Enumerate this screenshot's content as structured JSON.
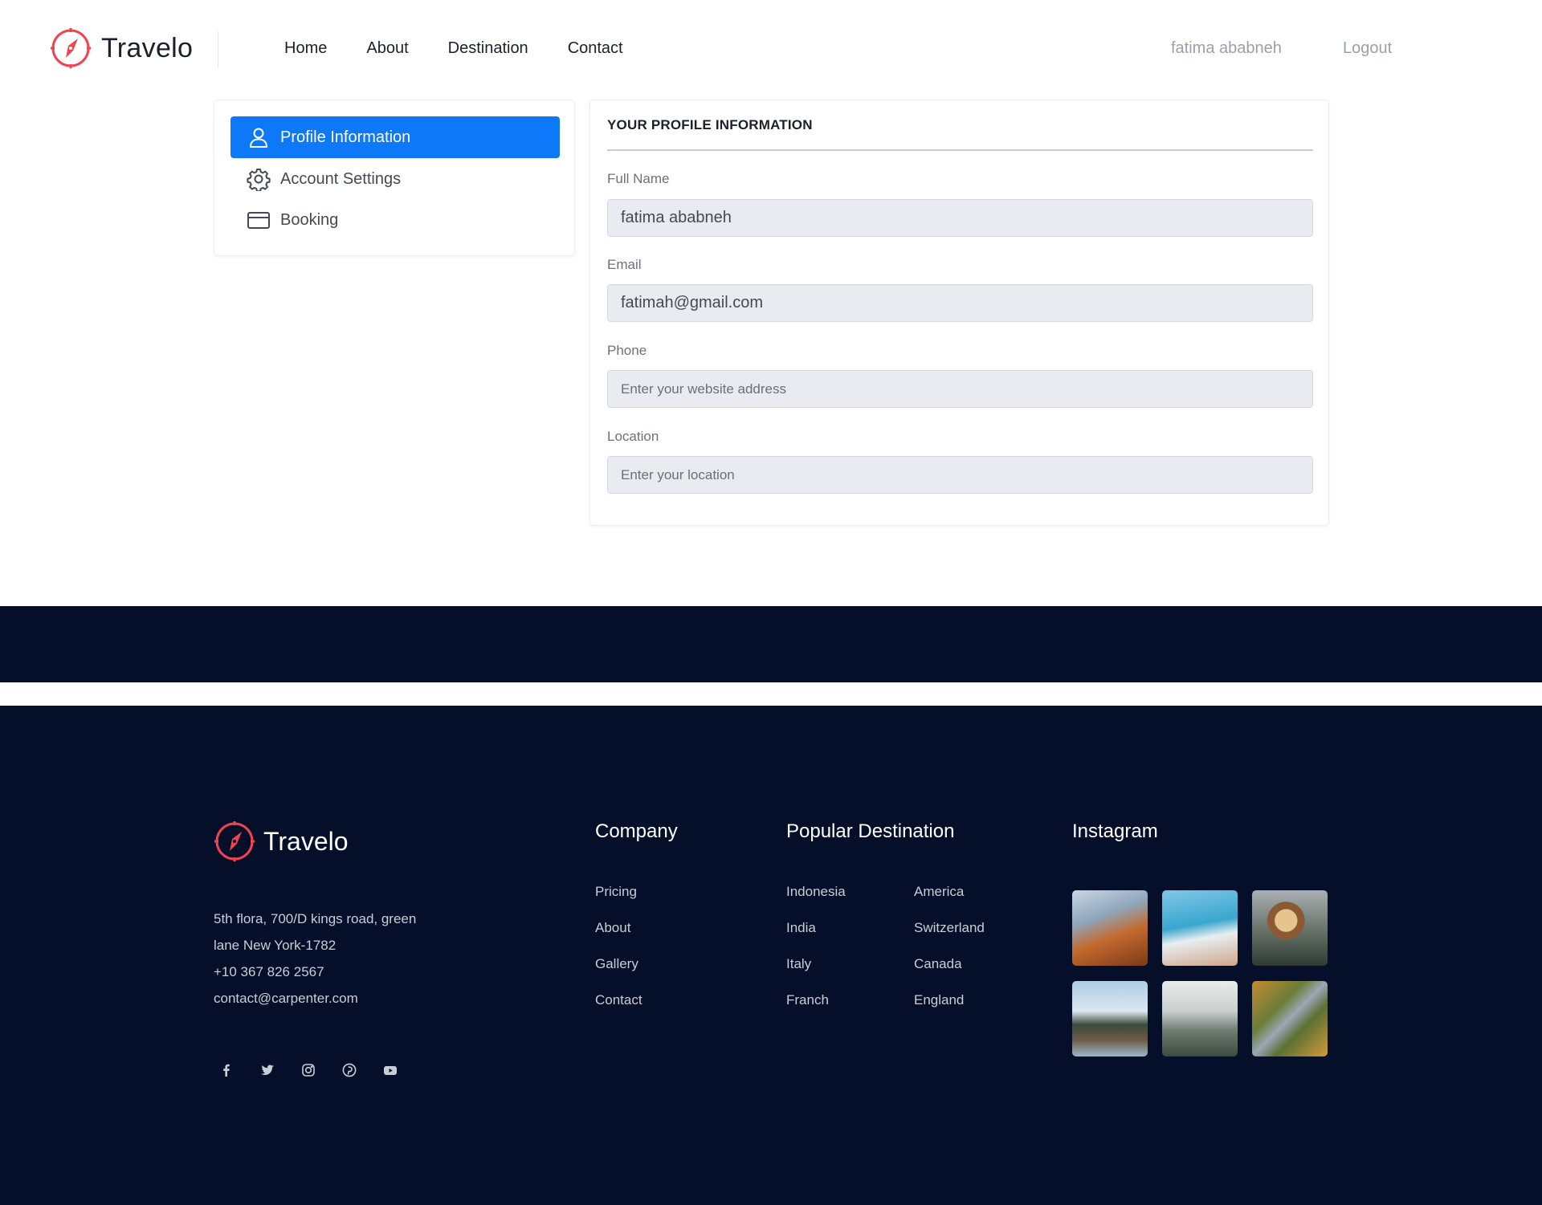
{
  "header": {
    "brand": "Travelo",
    "nav": [
      "Home",
      "About",
      "Destination",
      "Contact"
    ],
    "user_name": "fatima ababneh",
    "logout": "Logout"
  },
  "sidebar": {
    "items": [
      {
        "label": "Profile Information",
        "icon": "user-icon",
        "active": true
      },
      {
        "label": "Account Settings",
        "icon": "gear-icon",
        "active": false
      },
      {
        "label": "Booking",
        "icon": "credit-card-icon",
        "active": false
      }
    ]
  },
  "profile": {
    "title": "YOUR PROFILE INFORMATION",
    "fields": [
      {
        "label": "Full Name",
        "value": "fatima ababneh",
        "placeholder": ""
      },
      {
        "label": "Email",
        "value": "fatimah@gmail.com",
        "placeholder": ""
      },
      {
        "label": "Phone",
        "value": "",
        "placeholder": "Enter your website address"
      },
      {
        "label": "Location",
        "value": "",
        "placeholder": "Enter your location"
      }
    ]
  },
  "footer": {
    "brand": "Travelo",
    "address_line1": "5th flora, 700/D kings road, green",
    "address_line2": "lane New York-1782",
    "phone": "+10 367 826 2567",
    "email": "contact@carpenter.com",
    "social": [
      "facebook-icon",
      "twitter-icon",
      "instagram-icon",
      "pinterest-icon",
      "youtube-icon"
    ],
    "company": {
      "heading": "Company",
      "links": [
        "Pricing",
        "About",
        "Gallery",
        "Contact"
      ]
    },
    "destinations": {
      "heading": "Popular Destination",
      "col1": [
        "Indonesia",
        "India",
        "Italy",
        "Franch"
      ],
      "col2": [
        "America",
        "Switzerland",
        "Canada",
        "England"
      ]
    },
    "instagram": {
      "heading": "Instagram"
    }
  },
  "colors": {
    "accent": "#0d79f9",
    "brand_red": "#f0434f",
    "footer_bg": "#050f29"
  }
}
